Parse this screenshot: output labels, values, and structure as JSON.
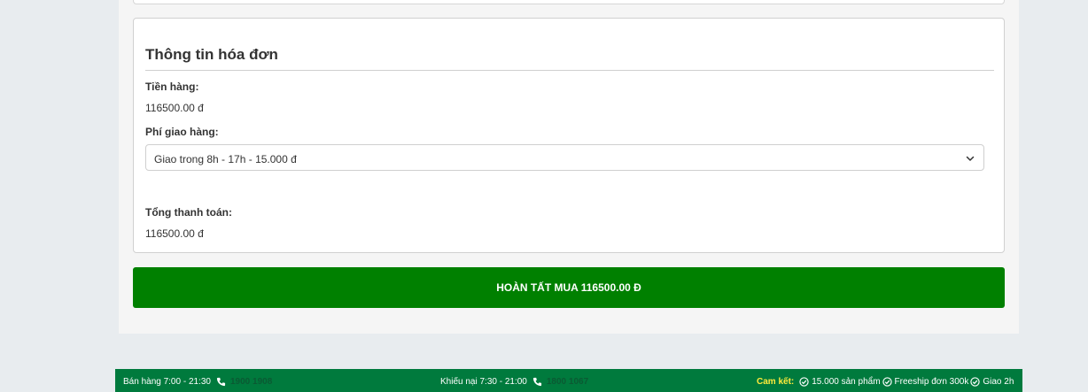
{
  "invoice": {
    "title": "Thông tin hóa đơn",
    "subtotal_label": "Tiền hàng:",
    "subtotal_value": "116500.00 đ",
    "shipping_label": "Phí giao hàng:",
    "shipping_selected": "Giao trong 8h - 17h - 15.000 đ",
    "total_label": "Tổng thanh toán:",
    "total_value": "116500.00 đ"
  },
  "complete_button": {
    "label": "HOÀN TẤT MUA 116500.00 Đ"
  },
  "footer": {
    "sales_hours": "Bán hàng 7:00 - 21:30",
    "sales_phone": "1900 1908",
    "complaint_hours": "Khiếu nại 7:30 - 21:00",
    "complaint_phone": "1800 1067",
    "commit_label": "Cam kết:",
    "commit_items": [
      "15.000 sản phẩm",
      "Freeship đơn 300k",
      "Giao 2h"
    ]
  },
  "colors": {
    "primary_green": "#008000",
    "footer_green": "#007a3d",
    "commit_yellow": "#ffeb3b"
  },
  "icons": [
    "chevron-down-icon",
    "phone-icon",
    "check-circle-icon"
  ]
}
